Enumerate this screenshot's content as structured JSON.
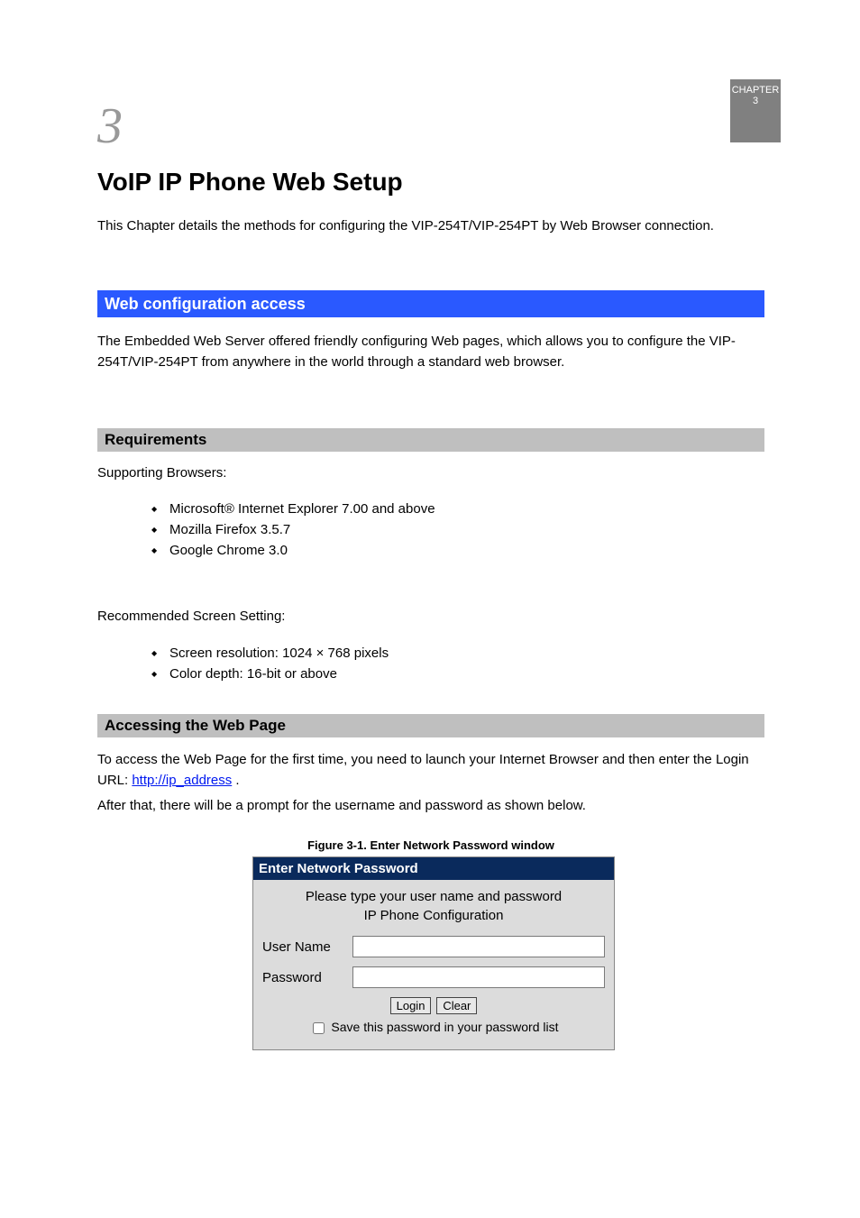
{
  "page": {
    "chapter_num": "3",
    "grey_tab": "CHAPTER 3",
    "chapter_title": "VoIP IP Phone Web Setup",
    "lead": "This Chapter details the methods for configuring the VIP-254T/VIP-254PT by Web Browser connection.",
    "blue_heading": "Web configuration access",
    "intro": "The Embedded Web Server offered friendly configuring Web pages, which allows you to configure the VIP-254T/VIP-254PT from anywhere in the world through a standard web browser.",
    "sub1": "Requirements",
    "supported_label": "Supporting Browsers:",
    "supported": [
      "Microsoft® Internet Explorer 7.00 and above",
      "Mozilla Firefox 3.5.7",
      "Google Chrome 3.0"
    ],
    "recommended_label": "Recommended Screen Setting:",
    "recommended": [
      "Screen resolution: 1024 × 768 pixels",
      "Color depth: 16-bit or above"
    ],
    "sub2": "Accessing the Web Page",
    "access_para1_prefix": "To access the Web Page for the first time, you need to launch your Internet Browser and then enter the Login URL: ",
    "access_link": "http://ip_address",
    "access_para1_suffix": ".",
    "access_para2": "After that, there will be a prompt for the username and password as shown below.",
    "figure_label": "Figure 3-1. Enter Network Password window"
  },
  "login": {
    "title": "Enter Network Password",
    "message": "Please type your user name and password",
    "subtitle": "IP Phone Configuration",
    "username_label": "User Name",
    "password_label": "Password",
    "username_value": "",
    "password_value": "",
    "login_btn": "Login",
    "clear_btn": "Clear",
    "save_label": "Save this password in your password list"
  }
}
